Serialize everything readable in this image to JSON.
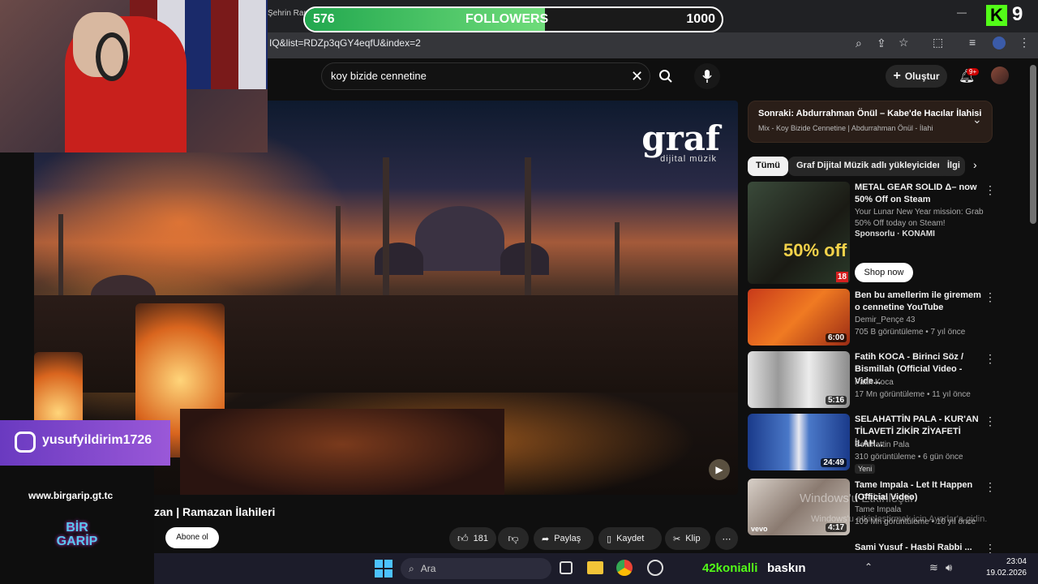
{
  "browser": {
    "tab_partial": "Şehrin Ram",
    "url": "IQ&list=RDZp3qGY4eqfU&index=2"
  },
  "overlay": {
    "followers": {
      "current": "576",
      "label": "FOLLOWERS",
      "goal": "1000",
      "progress": 0.576
    },
    "instagram_handle": "yusufyildirim1726",
    "website": "www.birgarip.gt.tc",
    "logo_text": "BİR GARİP",
    "kick_count": "9"
  },
  "header": {
    "search_value": "koy bizide cennetine",
    "create_label": "Oluştur",
    "notif_badge": "9+"
  },
  "video": {
    "channel_logo": "graf",
    "channel_logo_sub": "dijital müzik",
    "title_partial": "zan | Ramazan İlahileri",
    "subscribe_label": "Abone ol",
    "likes": "181",
    "share_label": "Paylaş",
    "save_label": "Kaydet",
    "clip_label": "Klip"
  },
  "upnext": {
    "title": "Sonraki: Abdurrahman Önül – Kabe'de Hacılar İlahisi",
    "subtitle": "Mix - Koy Bizide Cennetine | Abdurrahman Önül - İlahi"
  },
  "chips": [
    "Tümü",
    "Graf Dijital Müzik adlı yükleyiciden",
    "İlgi"
  ],
  "sidebar": [
    {
      "title": "METAL GEAR SOLID Δ– now 50% Off on Steam",
      "meta1": "Your Lunar New Year mission: Grab 50% Off today on Steam!",
      "meta2": "Sponsorlu · KONAMI",
      "sponsored": "Sponsorlu",
      "cta": "Shop now",
      "thumb_text": "50% off",
      "age_badge": "18"
    },
    {
      "title": "Ben bu amellerim ile giremem o cennetine YouTube",
      "channel": "Demir_Pençe 43",
      "stats": "705 B görüntüleme • 7 yıl önce",
      "duration": "6:00"
    },
    {
      "title": "Fatih KOCA - Birinci Söz / Bismillah (Official Video - Vide...",
      "channel": "Fatih Koca",
      "stats": "17 Mn görüntüleme • 11 yıl önce",
      "duration": "5:16"
    },
    {
      "title": "SELAHATTİN PALA - KUR'AN TİLAVETİ ZİKİR ZİYAFETİ İLAH...",
      "channel": "Selahattin Pala",
      "stats": "310 görüntüleme • 6 gün önce",
      "badge": "Yeni",
      "duration": "24:49"
    },
    {
      "title": "Tame Impala - Let It Happen (Official Video)",
      "channel": "Tame Impala",
      "stats": "109 Mn görüntüleme • 10 yıl önce",
      "duration": "4:17",
      "thumb_text": "vevo"
    },
    {
      "title": "Sami Yusuf - Hasbi Rabbi ..."
    }
  ],
  "windows_watermark": {
    "line1": "Windows'u Etkinleştir",
    "line2": "Windows'u etkinleştirmek için Ayarlar'a gidin."
  },
  "taskbar": {
    "search_label": "Ara",
    "raid_user": "42konialli",
    "raid_label": "baskın",
    "time": "23:04",
    "date": "19.02.2026"
  },
  "colors": {
    "follower_bar": "#2bb24c",
    "youtube_dark": "#0f0f0f",
    "accent_red": "#ff0000",
    "kick_green": "#53fc18"
  }
}
